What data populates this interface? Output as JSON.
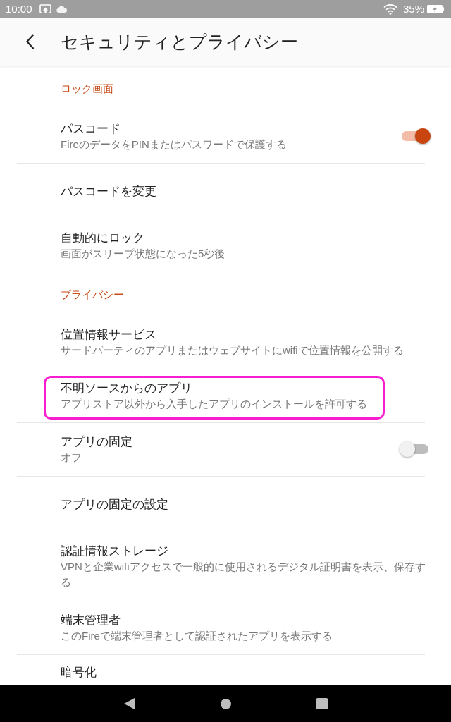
{
  "status_bar": {
    "time": "10:00",
    "battery": "35%"
  },
  "header": {
    "title": "セキュリティとプライバシー"
  },
  "sections": [
    {
      "header": "ロック画面",
      "items": [
        {
          "kind": "toggle",
          "title": "パスコード",
          "subtitle": "FireのデータをPINまたはパスワードで保護する",
          "on": true,
          "highlighted": false
        },
        {
          "kind": "link",
          "title": "パスコードを変更",
          "highlighted": false
        },
        {
          "kind": "link",
          "title": "自動的にロック",
          "subtitle": "画面がスリープ状態になった5秒後",
          "highlighted": false
        }
      ]
    },
    {
      "header": "プライバシー",
      "items": [
        {
          "kind": "link",
          "title": "位置情報サービス",
          "subtitle": "サードパーティのアプリまたはウェブサイトにwifiで位置情報を公開する",
          "highlighted": false
        },
        {
          "kind": "link",
          "title": "不明ソースからのアプリ",
          "subtitle": "アプリストア以外から入手したアプリのインストールを許可する",
          "highlighted": true
        },
        {
          "kind": "toggle",
          "title": "アプリの固定",
          "subtitle": "オフ",
          "on": false,
          "highlighted": false
        },
        {
          "kind": "link",
          "title": "アプリの固定の設定",
          "highlighted": false
        },
        {
          "kind": "link",
          "title": "認証情報ストレージ",
          "subtitle": "VPNと企業wifiアクセスで一般的に使用されるデジタル証明書を表示、保存する",
          "highlighted": false
        },
        {
          "kind": "link",
          "title": "端末管理者",
          "subtitle": "このFireで端末管理者として認証されたアプリを表示する",
          "highlighted": false
        },
        {
          "kind": "link",
          "title": "暗号化",
          "highlighted": false
        }
      ]
    }
  ]
}
